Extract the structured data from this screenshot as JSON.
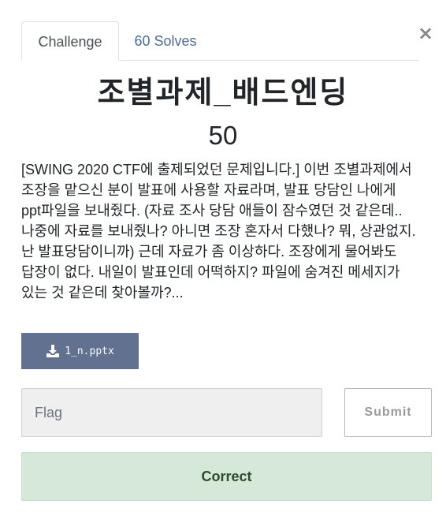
{
  "close": {
    "symbol": "×"
  },
  "tabs": [
    {
      "label": "Challenge",
      "active": true
    },
    {
      "label": "60 Solves",
      "active": false
    }
  ],
  "challenge": {
    "name": "조별과제_배드엔딩",
    "points": "50",
    "description": "[SWING 2020 CTF에 출제되었던 문제입니다.] 이번 조별과제에서 조장을 맡으신 분이 발표에 사용할 자료라며, 발표 당담인 나에게 ppt파일을 보내줬다. (자료 조사 당담 애들이 잠수였던 것 같은데.. 나중에 자료를 보내줬나? 아니면 조장 혼자서 다했나? 뭐, 상관없지. 난 발표당담이니까) 근데 자료가 좀 이상하다. 조장에게 물어봐도 답장이 없다. 내일이 발표인데 어떡하지? 파일에 숨겨진 메세지가 있는 것 같은데 찾아볼까?..."
  },
  "file": {
    "name": "1_n.pptx",
    "icon": "download-icon"
  },
  "flag": {
    "placeholder": "Flag",
    "value": ""
  },
  "submit": {
    "label": "Submit"
  },
  "result": {
    "message": "Correct",
    "status_color": "#d6e9d9"
  },
  "colors": {
    "accent": "#61718f",
    "tab_link": "#4e6b94"
  }
}
